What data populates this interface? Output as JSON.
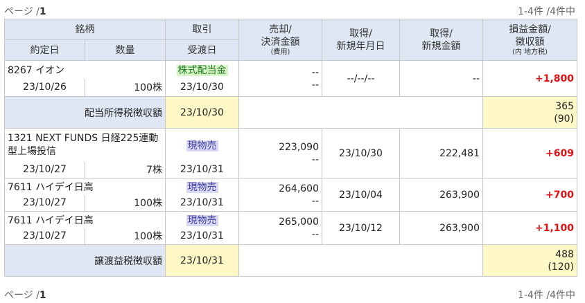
{
  "pager": {
    "page_label": "ページ /",
    "page_number": "1",
    "count": "1-4件 /4件中"
  },
  "headers": {
    "meigara": "銘柄",
    "torihiki": "取引",
    "yakujo_bi": "約定日",
    "suryo": "数量",
    "ukewatashi_bi": "受渡日",
    "baikyaku_1": "売却/",
    "baikyaku_2": "決済金額",
    "baikyaku_3": "(費用)",
    "shutoku_date_1": "取得/",
    "shutoku_date_2": "新規年月日",
    "shutoku_amt_1": "取得/",
    "shutoku_amt_2": "新規金額",
    "soneki_1": "損益金額/",
    "soneki_2": "徴収額",
    "soneki_3": "(内 地方税)"
  },
  "rows": [
    {
      "name": "8267 イオン",
      "trade": "株式配当金",
      "trade_kind": "dividend",
      "trade_date": "23/10/26",
      "qty": "100株",
      "settle_date": "23/10/30",
      "sale_amount": "--",
      "sale_fee": "--",
      "acq_date": "--/--/--",
      "acq_amount": "--",
      "pl": "+1,800"
    }
  ],
  "tax_dividend": {
    "label": "配当所得税徴収額",
    "date": "23/10/30",
    "amount": "365",
    "local": "(90)"
  },
  "sell_rows": [
    {
      "name": "1321 NEXT FUNDS 日経225連動型上場投信",
      "trade": "現物売",
      "trade_date": "23/10/27",
      "qty": "7株",
      "settle_date": "23/10/31",
      "sale_amount": "223,090",
      "sale_fee": "--",
      "acq_date": "23/10/30",
      "acq_amount": "222,481",
      "pl": "+609"
    },
    {
      "name": "7611 ハイデイ日高",
      "trade": "現物売",
      "trade_date": "23/10/27",
      "qty": "100株",
      "settle_date": "23/10/31",
      "sale_amount": "264,600",
      "sale_fee": "--",
      "acq_date": "23/10/04",
      "acq_amount": "263,900",
      "pl": "+700"
    },
    {
      "name": "7611 ハイデイ日高",
      "trade": "現物売",
      "trade_date": "23/10/27",
      "qty": "100株",
      "settle_date": "23/10/31",
      "sale_amount": "265,000",
      "sale_fee": "--",
      "acq_date": "23/10/12",
      "acq_amount": "263,900",
      "pl": "+1,100"
    }
  ],
  "tax_transfer": {
    "label": "譲渡益税徴収額",
    "date": "23/10/31",
    "amount": "488",
    "local": "(120)"
  },
  "colors": {
    "header_bg": "#dee7f3",
    "highlight_bg": "#fdf8c6",
    "profit": "#e31010",
    "dividend_tag_bg": "#d7f5c8",
    "sell_tag_bg": "#d9d9f5"
  }
}
